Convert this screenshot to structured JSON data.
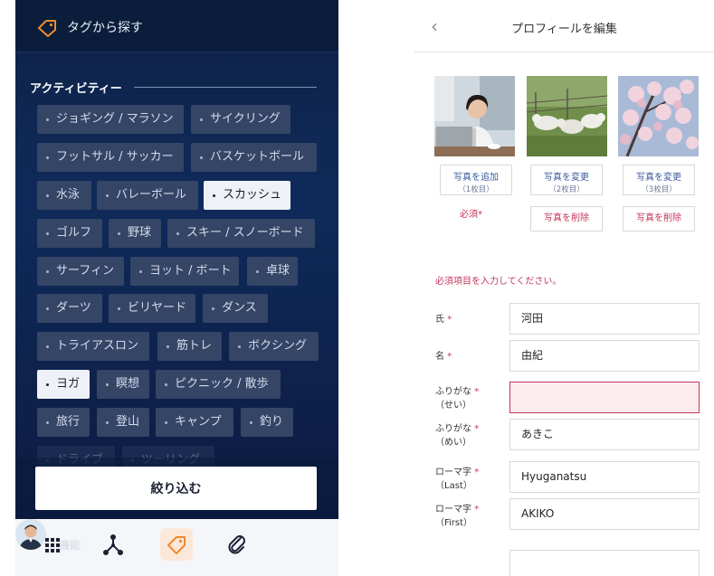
{
  "left": {
    "header_title": "タグから探す",
    "section_title": "アクティビティー",
    "chips": [
      {
        "label": "ジョギング / マラソン",
        "selected": false
      },
      {
        "label": "サイクリング",
        "selected": false
      },
      {
        "label": "フットサル / サッカー",
        "selected": false
      },
      {
        "label": "バスケットボール",
        "selected": false
      },
      {
        "label": "水泳",
        "selected": false
      },
      {
        "label": "バレーボール",
        "selected": false
      },
      {
        "label": "スカッシュ",
        "selected": true
      },
      {
        "label": "ゴルフ",
        "selected": false
      },
      {
        "label": "野球",
        "selected": false
      },
      {
        "label": "スキー / スノーボード",
        "selected": false
      },
      {
        "label": "サーフィン",
        "selected": false
      },
      {
        "label": "ヨット / ボート",
        "selected": false
      },
      {
        "label": "卓球",
        "selected": false
      },
      {
        "label": "ダーツ",
        "selected": false
      },
      {
        "label": "ビリヤード",
        "selected": false
      },
      {
        "label": "ダンス",
        "selected": false
      },
      {
        "label": "トライアスロン",
        "selected": false
      },
      {
        "label": "筋トレ",
        "selected": false
      },
      {
        "label": "ボクシング",
        "selected": false
      },
      {
        "label": "ヨガ",
        "selected": true
      },
      {
        "label": "瞑想",
        "selected": false
      },
      {
        "label": "ピクニック / 散歩",
        "selected": false
      },
      {
        "label": "旅行",
        "selected": false
      },
      {
        "label": "登山",
        "selected": false
      },
      {
        "label": "キャンプ",
        "selected": false
      },
      {
        "label": "釣り",
        "selected": false
      },
      {
        "label": "ドライブ",
        "selected": false
      },
      {
        "label": "ツーリング",
        "selected": false
      }
    ],
    "filter_button": "絞り込む",
    "nav_ghost_text": "機能",
    "nav_icons": [
      "apps-grid-icon",
      "network-icon",
      "tag-icon",
      "paperclip-icon",
      "avatar"
    ]
  },
  "right": {
    "page_title": "プロフィールを編集",
    "photos": [
      {
        "action_label": "写真を追加",
        "slot_label": "（1枚目）",
        "required_label": "必須*"
      },
      {
        "action_label": "写真を変更",
        "slot_label": "（2枚目）",
        "delete_label": "写真を削除"
      },
      {
        "action_label": "写真を変更",
        "slot_label": "（3枚目）",
        "delete_label": "写真を削除"
      }
    ],
    "error_message": "必須項目を入力してください。",
    "required_mark": "*",
    "fields": [
      {
        "label": "氏",
        "sub": "",
        "value": ""
      },
      {
        "label": "名",
        "sub": "",
        "value": ""
      },
      {
        "label": "ふりがな",
        "sub": "（せい）",
        "value": ""
      },
      {
        "label": "ふりがな",
        "sub": "（めい）",
        "value": ""
      },
      {
        "label": "ローマ字",
        "sub": "（Last）",
        "value": ""
      },
      {
        "label": "ローマ字",
        "sub": "（First）",
        "value": ""
      }
    ],
    "field_values": [
      "河田",
      "由紀",
      "",
      "あきこ",
      "Hyuganatsu",
      "AKIKO"
    ]
  },
  "colors": {
    "accent_orange": "#f0892e",
    "error_red": "#c2365a",
    "link_blue": "#3a5b9e",
    "panel_navy": "#0f2a5a",
    "chip_bg": "#354566"
  }
}
